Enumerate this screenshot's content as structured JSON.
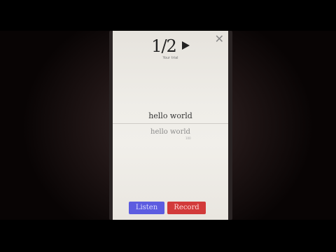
{
  "header": {
    "counter": "1/2",
    "subtitle": "Your trial"
  },
  "card": {
    "prompt": "hello world",
    "heard": "hello world",
    "score": "100"
  },
  "actions": {
    "listen_label": "Listen",
    "record_label": "Record"
  },
  "icons": {
    "play": "play-icon",
    "close": "close-icon"
  },
  "colors": {
    "listen": "#5c5ce0",
    "record": "#d23a3a"
  }
}
